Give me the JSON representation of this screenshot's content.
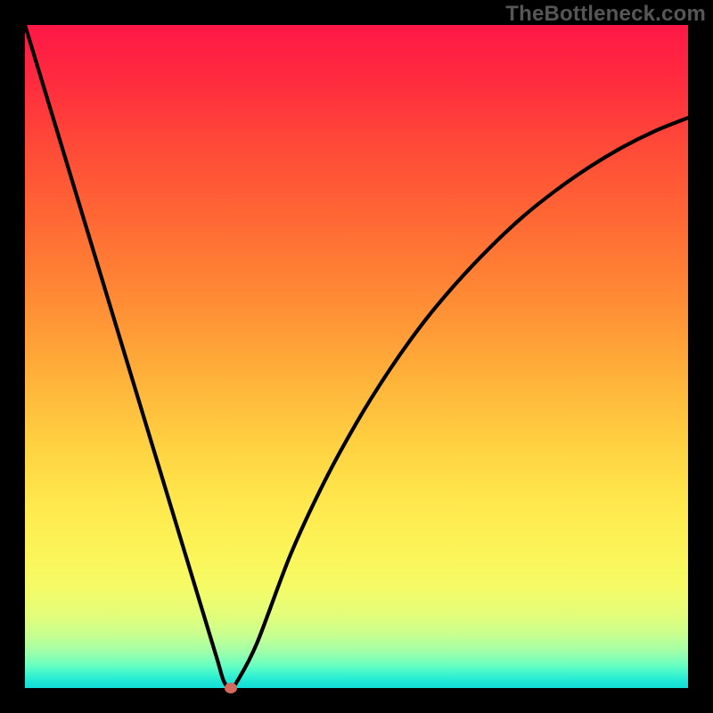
{
  "watermark": "TheBottleneck.com",
  "colors": {
    "page_background": "#000000",
    "curve_stroke": "#000000",
    "marker_fill": "#d46a5e",
    "gradient_top": "#ff1846",
    "gradient_bottom": "#12dcd6"
  },
  "chart_data": {
    "type": "line",
    "title": "",
    "xlabel": "",
    "ylabel": "",
    "xlim": [
      0,
      100
    ],
    "ylim": [
      0,
      100
    ],
    "grid": false,
    "legend": false,
    "x": [
      0,
      5,
      10,
      15,
      20,
      25,
      27,
      29,
      30,
      31,
      32,
      35,
      40,
      45,
      50,
      55,
      60,
      65,
      70,
      75,
      80,
      85,
      90,
      95,
      100
    ],
    "y": [
      100,
      83.5,
      67,
      50.5,
      34,
      17.5,
      10.9,
      4.3,
      1,
      0,
      1,
      6.8,
      20,
      30.8,
      40,
      48,
      55,
      61,
      66.3,
      71,
      75,
      78.5,
      81.5,
      84,
      86
    ],
    "marker": {
      "x": 31,
      "y": 0
    },
    "annotations": []
  }
}
